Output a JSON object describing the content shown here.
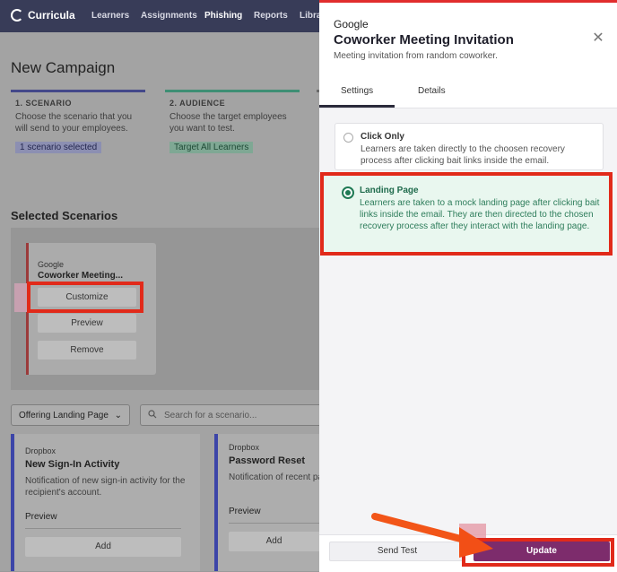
{
  "nav": {
    "brand": "Curricula",
    "items": [
      {
        "label": "Learners"
      },
      {
        "label": "Assignments"
      },
      {
        "label": "Phishing"
      },
      {
        "label": "Reports"
      },
      {
        "label": "Libra"
      }
    ]
  },
  "page": {
    "title": "New Campaign",
    "steps": [
      {
        "title": "1. SCENARIO",
        "desc": "Choose the scenario that you will send to your employees.",
        "badge": "1 scenario selected"
      },
      {
        "title": "2. AUDIENCE",
        "desc": "Choose the target employees you want to test.",
        "badge": "Target All Learners"
      }
    ],
    "selected_title": "Selected Scenarios",
    "selected_card": {
      "vendor": "Google",
      "name": "Coworker Meeting...",
      "customize": "Customize",
      "preview": "Preview",
      "remove": "Remove"
    },
    "filter_label": "Offering Landing Page",
    "search_placeholder": "Search for a scenario...",
    "library": [
      {
        "vendor": "Dropbox",
        "name": "New Sign-In Activity",
        "desc": "Notification of new sign-in activity for the recipient's account.",
        "preview": "Preview",
        "add": "Add"
      },
      {
        "vendor": "Dropbox",
        "name": "Password Reset",
        "desc": "Notification of recent pa",
        "preview": "Preview",
        "add": "Add"
      }
    ]
  },
  "drawer": {
    "vendor": "Google",
    "title": "Coworker Meeting Invitation",
    "desc": "Meeting invitation from random coworker.",
    "tabs": [
      {
        "label": "Settings"
      },
      {
        "label": "Details"
      }
    ],
    "options": [
      {
        "title": "Click Only",
        "desc": "Learners are taken directly to the choosen recovery process after clicking bait links inside the email.",
        "selected": false
      },
      {
        "title": "Landing Page",
        "desc": "Learners are taken to a mock landing page after clicking bait links inside the email. They are then directed to the chosen recovery process after they interact with the landing page.",
        "selected": true
      }
    ],
    "send_test": "Send Test",
    "update": "Update"
  },
  "colors": {
    "nav_bg": "#383c58",
    "accent_red": "#e12a1a",
    "selected_green": "#1f7a54",
    "update_purple": "#7d2c6c",
    "library_accent": "#3c45a8"
  },
  "icons": [
    "close-icon",
    "chevron-down-icon",
    "search-icon",
    "radio-icon",
    "arrow-annotation-icon"
  ]
}
